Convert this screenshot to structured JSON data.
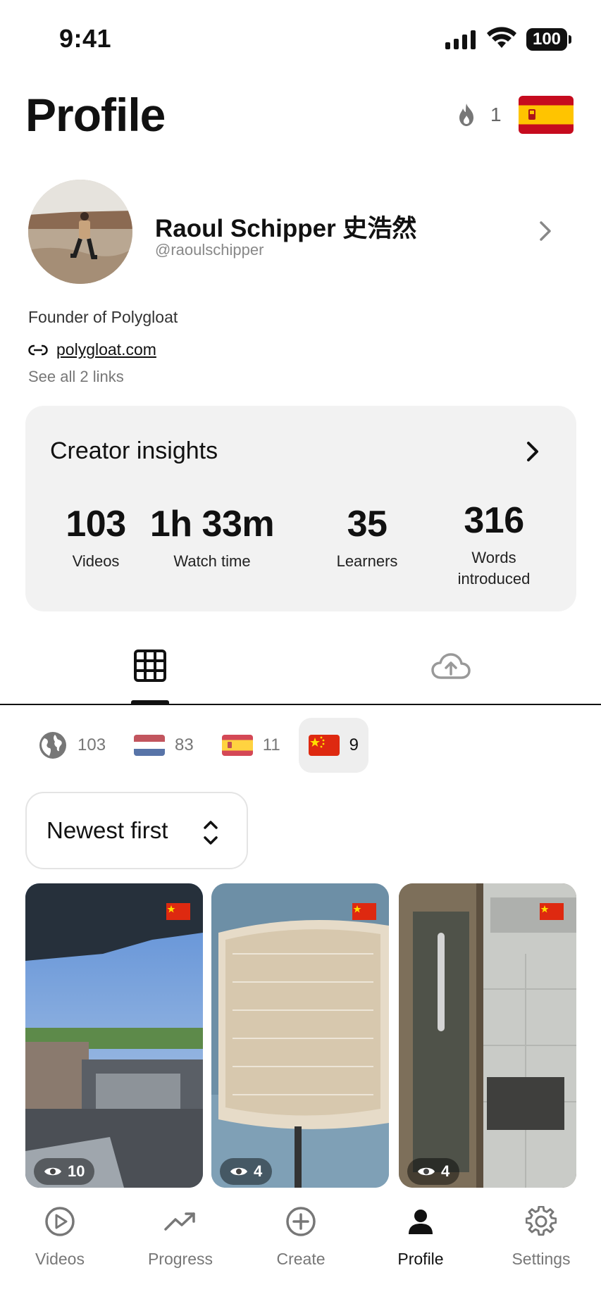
{
  "status_bar": {
    "time": "9:41",
    "battery": "100"
  },
  "header": {
    "title": "Profile",
    "streak_count": "1",
    "language_flag": "spain-flag"
  },
  "profile": {
    "name": "Raoul Schipper 史浩然",
    "handle": "@raoulschipper",
    "bio": "Founder of Polygloat",
    "link": "polygloat.com",
    "see_all_links": "See all 2 links"
  },
  "insights": {
    "title": "Creator insights",
    "stats": [
      {
        "value": "103",
        "label": "Videos"
      },
      {
        "value": "1h 33m",
        "label": "Watch time"
      },
      {
        "value": "35",
        "label": "Learners"
      },
      {
        "value": "316",
        "label": "Words introduced"
      }
    ]
  },
  "tabs": [
    {
      "icon": "grid-icon",
      "active": true
    },
    {
      "icon": "cloud-upload-icon",
      "active": false
    }
  ],
  "language_filter": [
    {
      "icon": "globe-icon",
      "count": "103",
      "active": false
    },
    {
      "icon": "netherlands-flag",
      "count": "83",
      "active": false
    },
    {
      "icon": "spain-flag",
      "count": "11",
      "active": false
    },
    {
      "icon": "china-flag",
      "count": "9",
      "active": true
    }
  ],
  "sort": {
    "label": "Newest first"
  },
  "videos": [
    {
      "views": "10",
      "flag": "china-flag"
    },
    {
      "views": "4",
      "flag": "china-flag"
    },
    {
      "views": "4",
      "flag": "china-flag"
    }
  ],
  "bottom_nav": [
    {
      "label": "Videos",
      "icon": "play-circle-icon",
      "active": false
    },
    {
      "label": "Progress",
      "icon": "trending-up-icon",
      "active": false
    },
    {
      "label": "Create",
      "icon": "plus-circle-icon",
      "active": false
    },
    {
      "label": "Profile",
      "icon": "person-icon",
      "active": true
    },
    {
      "label": "Settings",
      "icon": "gear-icon",
      "active": false
    }
  ],
  "colors": {
    "card_bg": "#f2f2f2",
    "active_chip_bg": "#eeeeee",
    "text": "#111111",
    "muted": "#777777"
  }
}
